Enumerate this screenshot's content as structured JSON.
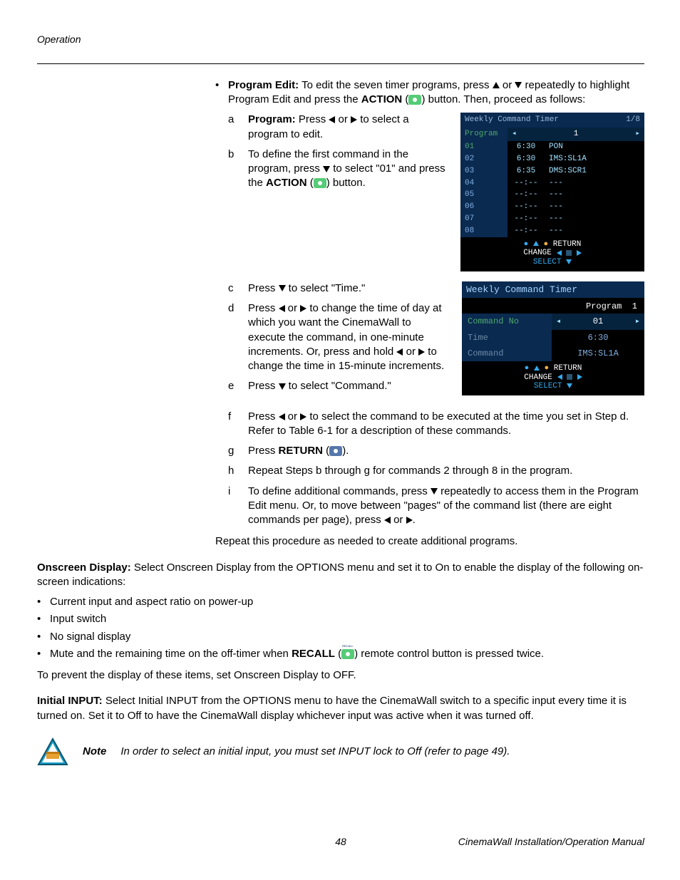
{
  "header": {
    "section": "Operation"
  },
  "footer": {
    "page": "48",
    "manual": "CinemaWall Installation/Operation Manual"
  },
  "pe": {
    "bullet_strong": "Program Edit:",
    "bullet_rest1": " To edit the seven timer programs, press ",
    "bullet_rest2": " or ",
    "bullet_rest3": " repeatedly to highlight Program Edit and press the ",
    "action_word": "ACTION",
    "bullet_rest4": " button. Then, proceed as follows:"
  },
  "steps": {
    "a": {
      "mk": "a",
      "strong": "Program:",
      "t1": " Press ",
      "t2": " or ",
      "t3": " to select a program to edit."
    },
    "b": {
      "mk": "b",
      "t1": "To define the first command in the program, press ",
      "t2": " to select \"01\" and press the ",
      "strong": "ACTION",
      "t3": " button."
    },
    "c": {
      "mk": "c",
      "t1": "Press ",
      "t2": " to select \"Time.\""
    },
    "d": {
      "mk": "d",
      "t1": "Press ",
      "t2": " or ",
      "t3": " to change the time of day at which you want the CinemaWall to execute the command, in one-minute increments. Or, press and hold ",
      "t4": " or ",
      "t5": " to change the time in 15-minute increments."
    },
    "e": {
      "mk": "e",
      "t1": "Press ",
      "t2": " to select \"Command.\""
    },
    "f": {
      "mk": "f",
      "t1": "Press ",
      "t2": " or ",
      "t3": " to select the command to be executed at the time you set in Step d. Refer to Table 6-1 for a description of these commands."
    },
    "g": {
      "mk": "g",
      "t1": "Press ",
      "strong": "RETURN",
      "t2": "."
    },
    "h": {
      "mk": "h",
      "t": "Repeat Steps b through g for commands 2 through 8 in the program."
    },
    "i": {
      "mk": "i",
      "t1": "To define additional commands, press ",
      "t2": " repeatedly to access them in the Program Edit menu. Or, to move between \"pages\" of the command list (there are eight commands per page), press ",
      "t3": " or ",
      "t4": "."
    }
  },
  "repeat_line": "Repeat this procedure as needed to create additional programs.",
  "osd_section": {
    "strong": "Onscreen Display:",
    "rest": " Select Onscreen Display from the OPTIONS menu and set it to On to enable the display of the following on-screen indications:",
    "items": [
      "Current input and aspect ratio on power-up",
      "Input switch",
      "No signal display"
    ],
    "mute1": "Mute and the remaining time on the off-timer when ",
    "recall_word": "RECALL",
    "mute2": " remote control button is pressed twice.",
    "off_line": "To prevent the display of these items, set Onscreen Display to OFF."
  },
  "initial": {
    "strong": "Initial INPUT:",
    "rest": " Select Initial INPUT from the OPTIONS menu to have the CinemaWall switch to a specific input every time it is turned on. Set it to Off to have the CinemaWall display whichever input was active when it was turned off."
  },
  "note": {
    "label": "Note",
    "msg": "In order to select an initial input, you must set INPUT lock to Off (refer to page 49)."
  },
  "osd1": {
    "title": "Weekly Command Timer",
    "page": "1/8",
    "head_label": "Program",
    "head_value": "1",
    "rows": [
      {
        "n": "01",
        "t": "6:30",
        "c": "PON"
      },
      {
        "n": "02",
        "t": "6:30",
        "c": "IMS:SL1A"
      },
      {
        "n": "03",
        "t": "6:35",
        "c": "DMS:SCR1"
      },
      {
        "n": "04",
        "t": "--:--",
        "c": "---"
      },
      {
        "n": "05",
        "t": "--:--",
        "c": "---"
      },
      {
        "n": "06",
        "t": "--:--",
        "c": "---"
      },
      {
        "n": "07",
        "t": "--:--",
        "c": "---"
      },
      {
        "n": "08",
        "t": "--:--",
        "c": "---"
      }
    ],
    "return": "RETURN",
    "change": "CHANGE",
    "select": "SELECT"
  },
  "osd2": {
    "title": "Weekly Command Timer",
    "program_label": "Program",
    "program_value": "1",
    "rows": {
      "cmdno": {
        "label": "Command No",
        "value": "01"
      },
      "time": {
        "label": "Time",
        "value": "6:30"
      },
      "cmd": {
        "label": "Command",
        "value": "IMS:SL1A"
      }
    },
    "return": "RETURN",
    "change": "CHANGE",
    "select": "SELECT"
  }
}
